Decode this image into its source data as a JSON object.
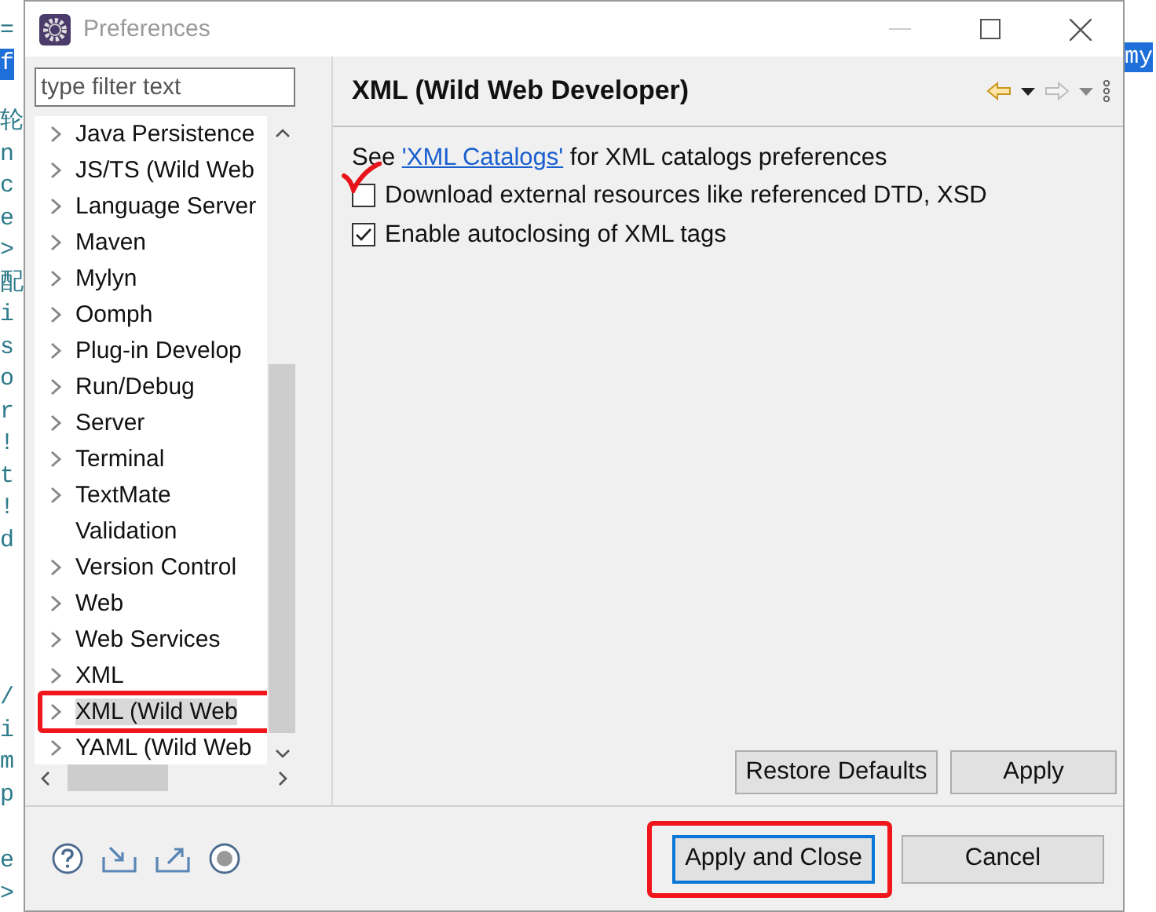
{
  "background_editor": {
    "left_blocks": [
      {
        "lines": [
          {
            "text": "=",
            "highlighted": false
          },
          {
            "text": "f",
            "highlighted": true
          }
        ]
      },
      {
        "lines": [
          {
            "text": "轮",
            "highlighted": false
          },
          {
            "text": "n",
            "highlighted": false
          },
          {
            "text": "c",
            "highlighted": false
          },
          {
            "text": "e",
            "highlighted": false
          },
          {
            "text": ">",
            "highlighted": false
          },
          {
            "text": "配",
            "highlighted": false
          },
          {
            "text": "i",
            "highlighted": false
          },
          {
            "text": "s",
            "highlighted": false
          },
          {
            "text": "o",
            "highlighted": false
          },
          {
            "text": "r",
            "highlighted": false
          },
          {
            "text": "!",
            "highlighted": false
          },
          {
            "text": "t",
            "highlighted": false
          },
          {
            "text": "!",
            "highlighted": false
          },
          {
            "text": "d",
            "highlighted": false
          }
        ]
      },
      {
        "lines": [
          {
            "text": "/",
            "highlighted": false
          },
          {
            "text": "i",
            "highlighted": false
          },
          {
            "text": "m",
            "highlighted": false
          },
          {
            "text": "p",
            "highlighted": false
          }
        ]
      },
      {
        "lines": [
          {
            "text": "e",
            "highlighted": false
          },
          {
            "text": ">",
            "highlighted": false
          }
        ]
      }
    ],
    "right_fragment": {
      "text": "my",
      "highlighted": true
    }
  },
  "window": {
    "title": "Preferences"
  },
  "filter": {
    "placeholder": "type filter text"
  },
  "tree": {
    "items": [
      {
        "label": "Java Persistence",
        "has_children": true,
        "selected": false,
        "annotated": false
      },
      {
        "label": "JS/TS (Wild Web",
        "has_children": true,
        "selected": false,
        "annotated": false
      },
      {
        "label": "Language Server",
        "has_children": true,
        "selected": false,
        "annotated": false
      },
      {
        "label": "Maven",
        "has_children": true,
        "selected": false,
        "annotated": false
      },
      {
        "label": "Mylyn",
        "has_children": true,
        "selected": false,
        "annotated": false
      },
      {
        "label": "Oomph",
        "has_children": true,
        "selected": false,
        "annotated": false
      },
      {
        "label": "Plug-in Develop",
        "has_children": true,
        "selected": false,
        "annotated": false
      },
      {
        "label": "Run/Debug",
        "has_children": true,
        "selected": false,
        "annotated": false
      },
      {
        "label": "Server",
        "has_children": true,
        "selected": false,
        "annotated": false
      },
      {
        "label": "Terminal",
        "has_children": true,
        "selected": false,
        "annotated": false
      },
      {
        "label": "TextMate",
        "has_children": true,
        "selected": false,
        "annotated": false
      },
      {
        "label": "Validation",
        "has_children": false,
        "selected": false,
        "annotated": false
      },
      {
        "label": "Version Control",
        "has_children": true,
        "selected": false,
        "annotated": false
      },
      {
        "label": "Web",
        "has_children": true,
        "selected": false,
        "annotated": false
      },
      {
        "label": "Web Services",
        "has_children": true,
        "selected": false,
        "annotated": false
      },
      {
        "label": "XML",
        "has_children": true,
        "selected": false,
        "annotated": false
      },
      {
        "label": "XML (Wild Web",
        "has_children": true,
        "selected": true,
        "annotated": true
      },
      {
        "label": "YAML (Wild Web",
        "has_children": true,
        "selected": false,
        "annotated": false
      }
    ]
  },
  "page": {
    "title": "XML (Wild Web Developer)",
    "intro": {
      "before": "See ",
      "link": "'XML Catalogs'",
      "after": " for XML catalogs preferences"
    },
    "options": [
      {
        "label": "Download external resources like referenced DTD, XSD",
        "checked": false,
        "annotated": true
      },
      {
        "label": "Enable autoclosing of XML tags",
        "checked": true,
        "annotated": false
      }
    ],
    "buttons": [
      "Restore Defaults",
      "Apply"
    ]
  },
  "footer_buttons": [
    {
      "label": "Apply and Close",
      "default": true,
      "annotated": true
    },
    {
      "label": "Cancel",
      "default": false,
      "annotated": false
    }
  ]
}
